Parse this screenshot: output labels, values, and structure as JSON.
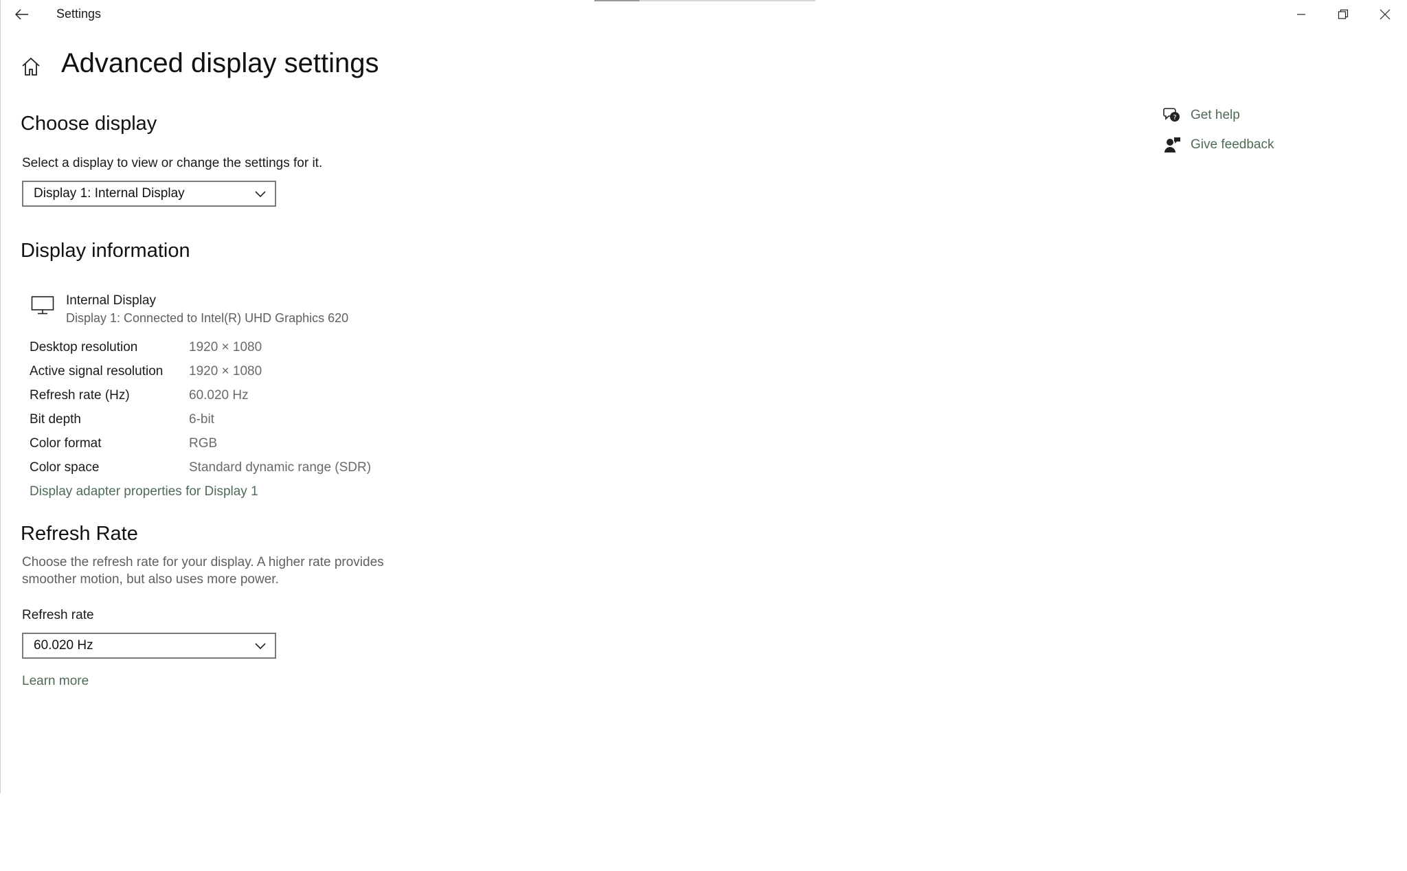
{
  "window": {
    "title": "Settings"
  },
  "page": {
    "title": "Advanced display settings"
  },
  "choose_display": {
    "heading": "Choose display",
    "description": "Select a display to view or change the settings for it.",
    "selected": "Display 1: Internal Display"
  },
  "display_info": {
    "heading": "Display information",
    "monitor_name": "Internal Display",
    "monitor_sub": "Display 1: Connected to Intel(R) UHD Graphics 620",
    "rows": [
      {
        "label": "Desktop resolution",
        "value": "1920 × 1080"
      },
      {
        "label": "Active signal resolution",
        "value": "1920 × 1080"
      },
      {
        "label": "Refresh rate (Hz)",
        "value": "60.020 Hz"
      },
      {
        "label": "Bit depth",
        "value": "6-bit"
      },
      {
        "label": "Color format",
        "value": "RGB"
      },
      {
        "label": "Color space",
        "value": "Standard dynamic range (SDR)"
      }
    ],
    "adapter_link": "Display adapter properties for Display 1"
  },
  "refresh": {
    "heading": "Refresh Rate",
    "description_line1": "Choose the refresh rate for your display. A higher rate provides",
    "description_line2": "smoother motion, but also uses more power.",
    "field_label": "Refresh rate",
    "selected": "60.020 Hz",
    "learn_more": "Learn more"
  },
  "help": {
    "get_help": "Get help",
    "give_feedback": "Give feedback"
  },
  "colors": {
    "link": "#4f6b55",
    "border": "#7a7a7a"
  },
  "icons": {
    "back": "back-arrow-icon",
    "home": "home-icon",
    "monitor": "monitor-icon",
    "help": "chat-help-icon",
    "feedback": "feedback-person-icon",
    "minimize": "minimize-icon",
    "restore": "restore-icon",
    "close": "close-icon",
    "chevron": "chevron-down-icon"
  }
}
